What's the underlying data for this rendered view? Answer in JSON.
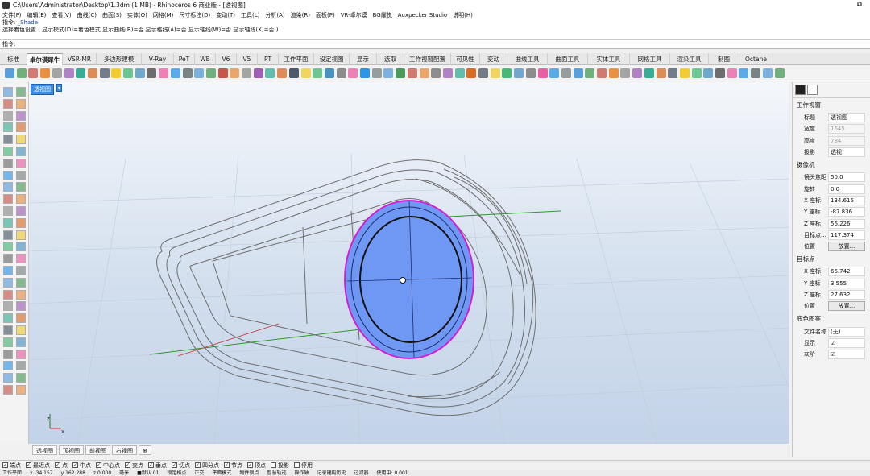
{
  "window": {
    "title": "C:\\Users\\Administrator\\Desktop\\1.3dm (1 MB) - Rhinoceros 6 商业版 - [透视图]",
    "restore_glyph": "⧉"
  },
  "menu": [
    "文件(F)",
    "编辑(E)",
    "查看(V)",
    "曲线(C)",
    "曲面(S)",
    "实体(O)",
    "网格(M)",
    "尺寸标注(D)",
    "变动(T)",
    "工具(L)",
    "分析(A)",
    "渲染(R)",
    "面板(P)",
    "VR-卓尔谟",
    "BG耀悦",
    "Auxpecker Studio",
    "说明(H)"
  ],
  "command_history": {
    "line1_prefix": "指令: ",
    "line1_cmd": "_Shade",
    "line2": "选择着色设置 ( 显示模式(D)=着色模式  显示曲线(R)=否  显示格线(A)=否  显示轴线(W)=否  显示轴线(X)=否 )"
  },
  "command_prompt": "指令:",
  "tabs": [
    "标准",
    "卓尔谟犀牛",
    "VSR-MR",
    "多边形建模",
    "V-Ray",
    "PeT",
    "WB",
    "V6",
    "V5",
    "PT",
    "工作平面",
    "设定视图",
    "显示",
    "选取",
    "工作视窗配置",
    "可见性",
    "变动",
    "曲线工具",
    "曲面工具",
    "实体工具",
    "网格工具",
    "渲染工具",
    "制图",
    "Octane"
  ],
  "active_tab_index": 1,
  "viewport": {
    "label": "透视图",
    "label_arrow": "▾",
    "axis_z": "z",
    "axis_x": "x"
  },
  "viewport_tabs": [
    "透视图",
    "顶视图",
    "前视图",
    "右视图",
    "⊕"
  ],
  "osnaps": [
    {
      "label": "端点",
      "checked": true
    },
    {
      "label": "最近点",
      "checked": true
    },
    {
      "label": "点",
      "checked": true
    },
    {
      "label": "中点",
      "checked": true
    },
    {
      "label": "中心点",
      "checked": true
    },
    {
      "label": "交点",
      "checked": true
    },
    {
      "label": "垂点",
      "checked": true
    },
    {
      "label": "切点",
      "checked": true
    },
    {
      "label": "四分点",
      "checked": true
    },
    {
      "label": "节点",
      "checked": true
    },
    {
      "label": "顶点",
      "checked": true
    },
    {
      "label": "投影",
      "checked": false
    },
    {
      "label": "停用",
      "checked": false
    }
  ],
  "statusbar": [
    "工作平面",
    "x -34.157",
    "y 162.288",
    "z 0.000",
    "毫米",
    "■默认 01",
    "锁定格点",
    "正交",
    "平面模式",
    "物件锁点",
    "智慧轨迹",
    "操作轴",
    "记录建构历史",
    "过滤器",
    "使用中: 0.001"
  ],
  "right_panel": {
    "viewport_section": "工作视窗",
    "rows_viewport": [
      {
        "k": "标题",
        "v": "透视图",
        "disabled": false
      },
      {
        "k": "宽度",
        "v": "1645",
        "disabled": true
      },
      {
        "k": "高度",
        "v": "784",
        "disabled": true
      },
      {
        "k": "投影",
        "v": "透视",
        "disabled": false
      }
    ],
    "camera_section": "摄像机",
    "rows_camera": [
      {
        "k": "镜头焦距",
        "v": "50.0"
      },
      {
        "k": "旋转",
        "v": "0.0"
      },
      {
        "k": "X 座标",
        "v": "134.615"
      },
      {
        "k": "Y 座标",
        "v": "-87.836"
      },
      {
        "k": "Z 座标",
        "v": "56.226"
      },
      {
        "k": "目标点...",
        "v": "117.374"
      }
    ],
    "position_label": "位置",
    "place_button": "放置...",
    "target_section": "目标点",
    "rows_target": [
      {
        "k": "X 座标",
        "v": "66.742"
      },
      {
        "k": "Y 座标",
        "v": "3.555"
      },
      {
        "k": "Z 座标",
        "v": "27.632"
      }
    ],
    "background_section": "底色图案",
    "rows_background": [
      {
        "k": "文件名称",
        "v": "(无)"
      },
      {
        "k": "显示",
        "v": "☑"
      },
      {
        "k": "灰阶",
        "v": "☑"
      }
    ],
    "browse_button": "..."
  }
}
